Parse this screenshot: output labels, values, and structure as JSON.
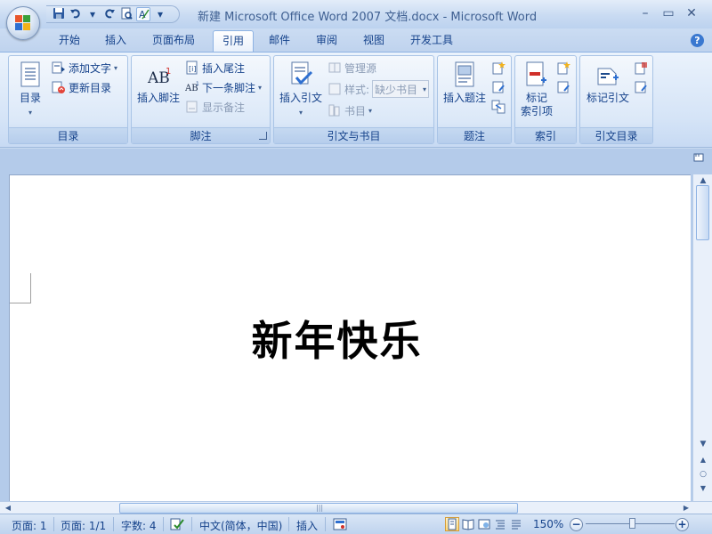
{
  "window": {
    "title": "新建 Microsoft Office Word 2007 文档.docx - Microsoft Word",
    "minimize": "–",
    "maximize": "▭",
    "close": "✕"
  },
  "qat": {
    "save_icon": "save-icon",
    "undo_icon": "undo-icon",
    "redo_icon": "redo-icon",
    "preview_icon": "print-preview-icon",
    "spell_icon": "spelling-icon",
    "more": "▾"
  },
  "tabs": [
    "开始",
    "插入",
    "页面布局",
    "引用",
    "邮件",
    "审阅",
    "视图",
    "开发工具"
  ],
  "active_tab": "引用",
  "help": "?",
  "ribbon": {
    "toc": {
      "label": "目录",
      "big_button": "目录",
      "add_text": "添加文字",
      "update": "更新目录"
    },
    "footnotes": {
      "label": "脚注",
      "insert_footnote": "插入脚注",
      "insert_endnote": "插入尾注",
      "next_footnote": "下一条脚注",
      "show_notes": "显示备注"
    },
    "citations": {
      "label": "引文与书目",
      "insert_citation": "插入引文",
      "manage_sources": "管理源",
      "style_label": "样式:",
      "style_value": "缺少书目",
      "bibliography": "书目"
    },
    "captions": {
      "label": "题注",
      "insert_caption": "插入题注"
    },
    "index": {
      "label": "索引",
      "mark_entry_line1": "标记",
      "mark_entry_line2": "索引项"
    },
    "toa": {
      "label": "引文目录",
      "mark_citation": "标记引文"
    }
  },
  "document": {
    "text": "新年快乐"
  },
  "statusbar": {
    "page": "页面: 1",
    "pages": "页面: 1/1",
    "words": "字数: 4",
    "language": "中文(简体，中国)",
    "mode": "插入",
    "zoom": "150%",
    "zoom_level_percent": 150
  },
  "colors": {
    "accent": "#15428b",
    "ribbon": "#d5e4f7",
    "active_view": "#ffd776"
  }
}
